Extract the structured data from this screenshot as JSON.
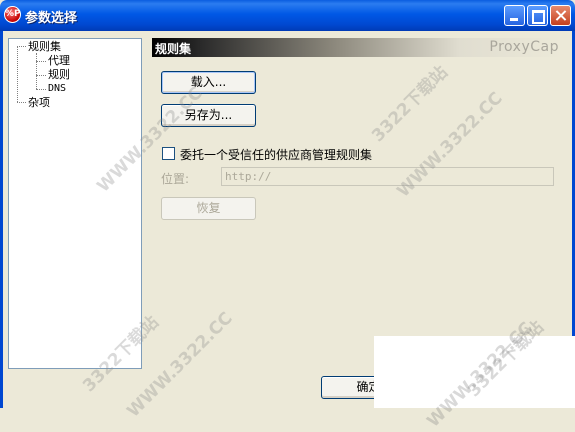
{
  "window": {
    "title": "参数选择",
    "app_icon": "proxycap-app-icon",
    "app_icon_glyph": "%P",
    "controls": [
      "minimize-icon",
      "maximize-icon",
      "close-icon"
    ]
  },
  "tree": {
    "items": [
      {
        "label": "规则集"
      },
      {
        "label": "代理"
      },
      {
        "label": "规则"
      },
      {
        "label": "DNS"
      },
      {
        "label": "杂项"
      }
    ]
  },
  "panel": {
    "title": "规则集",
    "brand": "ProxyCap",
    "load_label": "载入...",
    "save_as_label": "另存为...",
    "trust_provider_label": "委托一个受信任的供应商管理规则集",
    "trust_provider_checked": false,
    "location_label": "位置:",
    "location_value": "http://",
    "restore_label": "恢复"
  },
  "footer": {
    "ok_label": "确定"
  },
  "watermark": {
    "text1": "3322下载站",
    "text2": "WWW.3322.CC"
  },
  "colors": {
    "titlebar": "#0058e6",
    "dialog_bg": "#ece9d8",
    "button_border": "#003c74",
    "disabled_text": "#aca899"
  }
}
